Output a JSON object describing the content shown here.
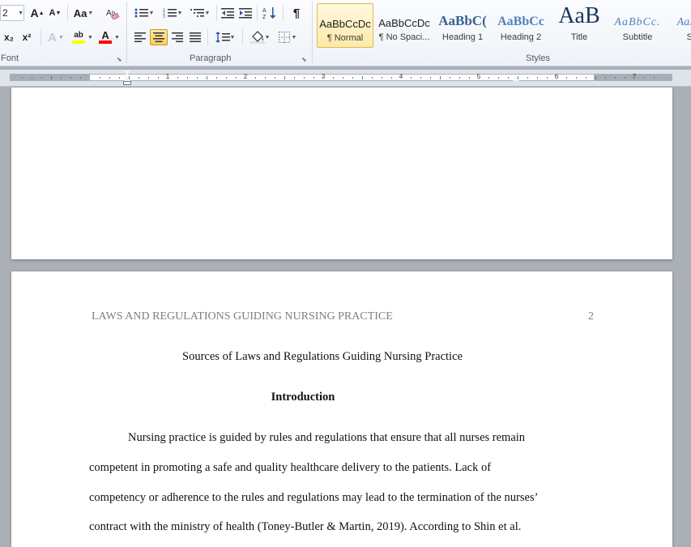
{
  "ribbon": {
    "font_size_partial": "2",
    "font_group_label": "Font",
    "paragraph_group_label": "Paragraph",
    "styles_group_label": "Styles",
    "change_case_label": "Aa",
    "grow_font_label": "A",
    "shrink_font_label": "A",
    "subscript_label": "x₂",
    "superscript_label": "x²",
    "text_effects_label": "A",
    "highlight_label": "ab",
    "font_color_label": "A",
    "pilcrow_label": "¶"
  },
  "styles": [
    {
      "sample": "AaBbCcDc",
      "name": "¶ Normal",
      "selected": true
    },
    {
      "sample": "AaBbCcDc",
      "name": "¶ No Spaci..."
    },
    {
      "sample": "AaBbC(",
      "name": "Heading 1"
    },
    {
      "sample": "AaBbCc",
      "name": "Heading 2"
    },
    {
      "sample": "AaB",
      "name": "Title"
    },
    {
      "sample": "AaBbCc.",
      "name": "Subtitle"
    },
    {
      "sample": "AaBbCc",
      "name": "Subt"
    }
  ],
  "ruler": {
    "numbers": [
      "1",
      "2",
      "3",
      "4",
      "5",
      "6",
      "7"
    ]
  },
  "document": {
    "running_head": "LAWS AND REGULATIONS GUIDING NURSING PRACTICE",
    "page_number": "2",
    "title": "Sources of Laws and Regulations Guiding Nursing Practice",
    "heading": "Introduction",
    "lines": [
      "Nursing practice is guided by rules and regulations that ensure that all nurses remain",
      "competent in promoting a safe and quality healthcare delivery to the patients. Lack of",
      "competency or adherence to the rules and regulations may lead to the termination of the nurses’",
      "contract with the ministry of health (Toney-Butler & Martin, 2019).  According to Shin et al."
    ]
  }
}
